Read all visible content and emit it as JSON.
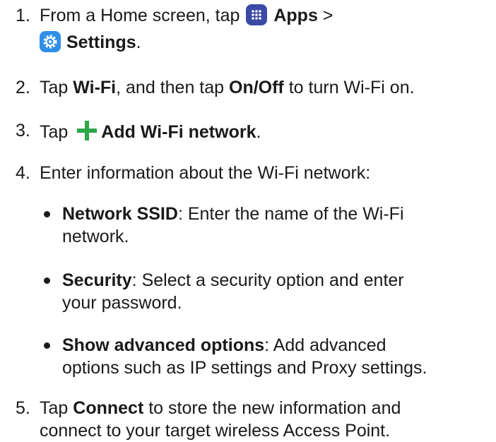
{
  "steps": [
    {
      "number": "1.",
      "line1_prefix": "From a Home screen, tap",
      "apps_label": "Apps",
      "apps_suffix": ">",
      "settings_label": "Settings",
      "settings_suffix": "."
    },
    {
      "number": "2.",
      "prefix": "Tap",
      "wifi_label": "Wi-Fi",
      "middle": ", and then tap",
      "onoff_label": "On/Off",
      "suffix": "to turn Wi-Fi on."
    },
    {
      "number": "3.",
      "prefix": "Tap",
      "add_label": "Add Wi-Fi network",
      "suffix": "."
    },
    {
      "number": "4.",
      "text": "Enter information about the Wi-Fi network:",
      "bullets": [
        {
          "term": "Network SSID",
          "line1": ": Enter the name of the Wi-Fi",
          "line2": "network."
        },
        {
          "term": "Security",
          "line1": ": Select a security option and enter",
          "line2": "your password."
        },
        {
          "term": "Show advanced options",
          "line1": ": Add advanced",
          "line2": "options such as IP settings and Proxy settings."
        }
      ]
    },
    {
      "number": "5.",
      "prefix": "Tap",
      "connect_label": "Connect",
      "line1_suffix": "to store the new information and",
      "line2": "connect to your target wireless Access Point."
    }
  ],
  "icons": {
    "apps": "apps-grid-icon",
    "settings": "gear-icon",
    "add": "plus-icon"
  },
  "colors": {
    "apps_icon_bg": "#3b4aa7",
    "settings_icon_bg": "#2f8fe6",
    "plus_icon": "#2ea84a",
    "text": "#1a1a1a"
  }
}
